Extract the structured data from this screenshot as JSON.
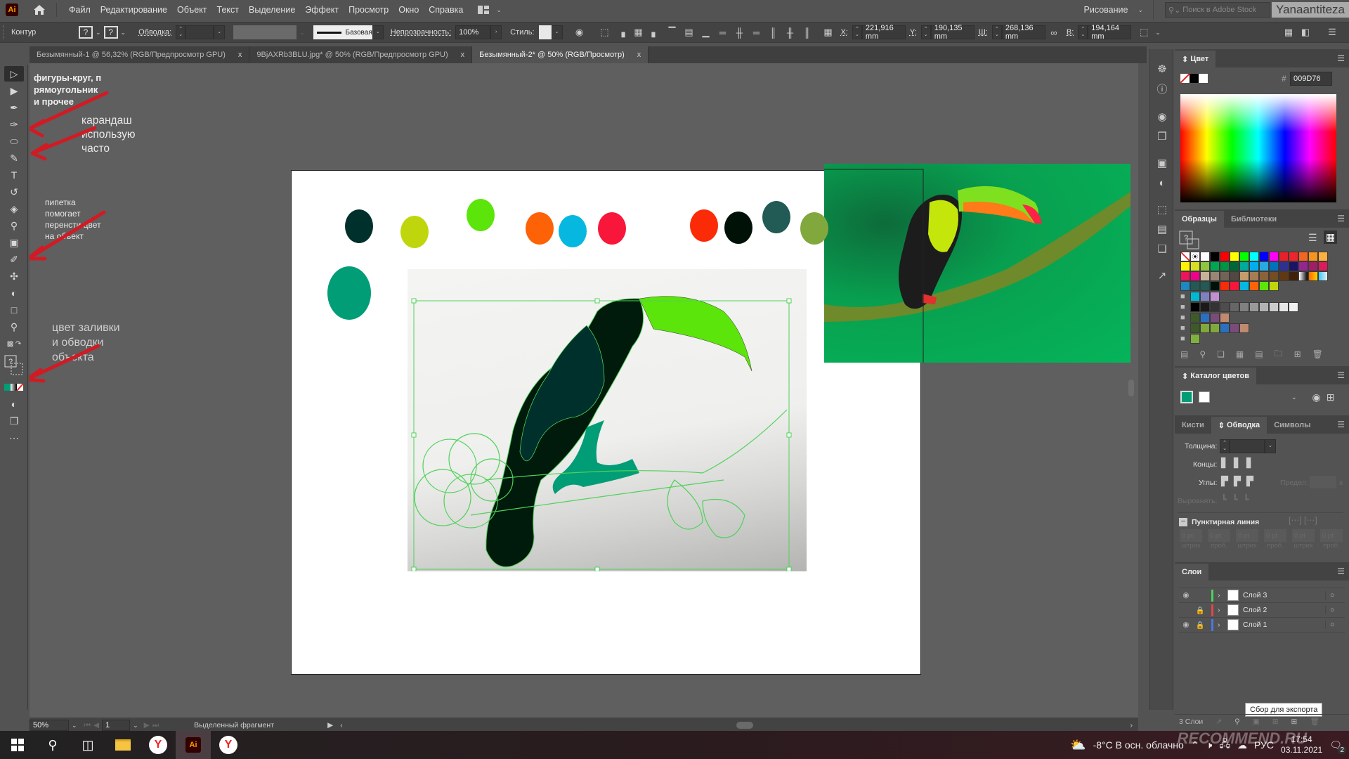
{
  "app": {
    "logo": "Ai",
    "home_icon": "home-icon"
  },
  "menu": [
    "Файл",
    "Редактирование",
    "Объект",
    "Текст",
    "Выделение",
    "Эффект",
    "Просмотр",
    "Окно",
    "Справка"
  ],
  "workspace": "Рисование",
  "stock_search_placeholder": "Поиск в Adobe Stock",
  "username": "Yanaantiteza",
  "control": {
    "mode": "Контур",
    "fill_q": "?",
    "stroke_q": "?",
    "stroke_label": "Обводка:",
    "profile": "Базовая",
    "opacity_label": "Непрозрачность:",
    "opacity": "100%",
    "style_label": "Стиль:",
    "x_label": "X:",
    "x": "221,916 mm",
    "y_label": "Y:",
    "y": "190,135 mm",
    "w_label": "Ш:",
    "w": "268,136 mm",
    "h_label": "В:",
    "h": "194,164 mm"
  },
  "tabs": [
    {
      "label": "Безымянный-1 @ 56,32% (RGB/Предпросмотр GPU)",
      "active": false
    },
    {
      "label": "9BjAXRb3BLU.jpg* @ 50% (RGB/Предпросмотр GPU)",
      "active": false
    },
    {
      "label": "Безымянный-2* @ 50% (RGB/Просмотр)",
      "active": true
    }
  ],
  "tab_close": "x",
  "annotations": {
    "shapes": "фигуры-круг, п\nрямоугольник\nи прочее",
    "pencil": "карандаш\nиспользую\nчасто",
    "eyedropper": "пипетка\nпомогает\nперенсти цвет\nна объект",
    "fill_stroke": "цвет заливки\nи обводки\nобъекта"
  },
  "artboard_swatches": [
    {
      "color": "#00302c"
    },
    {
      "color": "#bfd60c"
    },
    {
      "color": "#5be50a"
    },
    {
      "color": "#fd6207"
    },
    {
      "color": "#06b8e0"
    },
    {
      "color": "#f8163a"
    },
    {
      "color": "#fb2a07"
    },
    {
      "color": "#001208"
    },
    {
      "color": "#225a55"
    },
    {
      "color": "#80a83d"
    },
    {
      "color": "#009d76"
    }
  ],
  "color_panel": {
    "title": "Цвет",
    "hex_label": "#",
    "hex": "009D76"
  },
  "swatches_panel": {
    "tabs": [
      "Образцы",
      "Библиотеки"
    ],
    "rows": [
      [
        "none",
        "reg",
        "#ffffff",
        "#000000",
        "#ff0000",
        "#ffff00",
        "#00ff00",
        "#00ffff",
        "#0000ff",
        "#ff00ff",
        "#e8202a",
        "#f0242c",
        "#f26522",
        "#f7941d",
        "#fbb040"
      ],
      [
        "#fff200",
        "#d7df23",
        "#8dc63f",
        "#00a651",
        "#009444",
        "#006837",
        "#00a99d",
        "#00aeef",
        "#27aae1",
        "#0072bc",
        "#2e3192",
        "#1b1464",
        "#92278f",
        "#9e1f63",
        "#d91c5c"
      ],
      [
        "#ed145b",
        "#ec008c",
        "#c7b299",
        "#998675",
        "#736357",
        "#534741",
        "#c69c6d",
        "#a67c52",
        "#8c6239",
        "#754c24",
        "#603813",
        "#42210b",
        "grad1",
        "grad2",
        "grad3"
      ],
      [
        "#1e88c0",
        "#225a55",
        "#225a55",
        "#001208",
        "#fb2a07",
        "#f8163a",
        "#06b8e0",
        "#fd6207",
        "#5be50a",
        "#bfd60c"
      ]
    ],
    "groups": [
      [
        "#00b8d4",
        "#8080c0",
        "#c090d0"
      ],
      [
        "#000000",
        "#1a1a1a",
        "#333333",
        "#4d4d4d",
        "#666666",
        "#808080",
        "#999999",
        "#b3b3b3",
        "#cccccc",
        "#e6e6e6",
        "#f2f2f2"
      ],
      [
        "#3d5a28",
        "#2b70c0",
        "#7a4c7a",
        "#c08a70"
      ],
      [
        "#3d5a28",
        "#80a83d",
        "#80a83d",
        "#2b70c0",
        "#7a4c7a",
        "#c08a70"
      ],
      [
        "#80b040"
      ]
    ]
  },
  "catalog_panel": {
    "title": "Каталог цветов",
    "fill": "#009d76",
    "stroke": "#ffffff"
  },
  "stroke_panel": {
    "tabs": [
      "Кисти",
      "Обводка",
      "Символы"
    ],
    "weight_label": "Толщина:",
    "caps_label": "Концы:",
    "corners_label": "Углы:",
    "limit_label": "Предел:",
    "limit_x": "x",
    "align_label": "Выровнять:",
    "dashed_label": "Пунктирная линия",
    "dash_values": [
      "0 pt",
      "0 pt",
      "0 pt",
      "0 pt",
      "0 pt",
      "0 pt"
    ],
    "dash_labels": [
      "штрих",
      "проб.",
      "штрих",
      "проб.",
      "штрих",
      "проб."
    ]
  },
  "layers_panel": {
    "title": "Слои",
    "layers": [
      {
        "name": "Слой 3",
        "color": "#4fd15a",
        "visible": true,
        "locked": false
      },
      {
        "name": "Слой 2",
        "color": "#e04848",
        "visible": false,
        "locked": true
      },
      {
        "name": "Слой 1",
        "color": "#4a78e0",
        "visible": true,
        "locked": true
      }
    ],
    "count": "3 Слои",
    "tooltip": "Сбор для экспорта"
  },
  "status": {
    "zoom": "50%",
    "artboard": "1",
    "info": "Выделенный фрагмент"
  },
  "taskbar": {
    "weather": "-8°C  В осн. облачно",
    "lang": "РУС",
    "time": "17:54",
    "date": "03.11.2021",
    "notifications": "2",
    "watermark": "RECOMMEND.RU"
  }
}
